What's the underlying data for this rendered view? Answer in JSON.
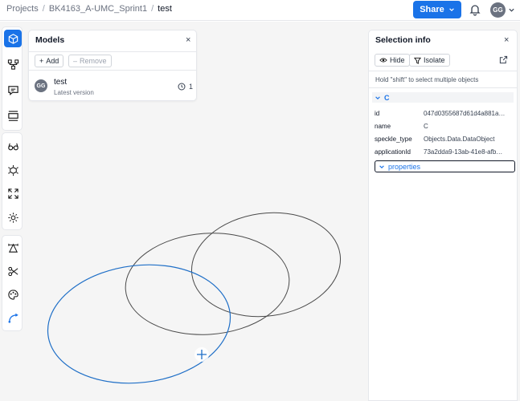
{
  "breadcrumb": {
    "root": "Projects",
    "project": "BK4163_A-UMC_Sprint1",
    "model": "test"
  },
  "share_label": "Share",
  "user_initials": "GG",
  "toolbar_icons": [
    "cube-icon",
    "branches-icon",
    "comment-icon",
    "section-box-icon",
    "glasses-icon",
    "explode-icon",
    "fit-icon",
    "sun-icon",
    "measure-icon",
    "scissors-icon",
    "palette-icon",
    "arc-icon"
  ],
  "models": {
    "title": "Models",
    "close": "×",
    "add_label": "Add",
    "remove_label": "Remove",
    "item": {
      "initials": "GG",
      "name": "test",
      "subtitle": "Latest version",
      "versions": "1"
    }
  },
  "selection": {
    "title": "Selection info",
    "close": "×",
    "hide_label": "Hide",
    "isolate_label": "Isolate",
    "hint": "Hold \"shift\" to select multiple objects",
    "object_name": "C",
    "fields": [
      {
        "key": "id",
        "value": "047d0355687d61d4a881a…"
      },
      {
        "key": "name",
        "value": "C"
      },
      {
        "key": "speckle_type",
        "value": "Objects.Data.DataObject"
      },
      {
        "key": "applicationId",
        "value": "73a2dda9-13ab-41e8-afb…"
      }
    ],
    "properties_label": "properties"
  },
  "colors": {
    "accent": "#1a73e8",
    "selected_curve": "#1f6fc7",
    "curve": "#444444"
  }
}
